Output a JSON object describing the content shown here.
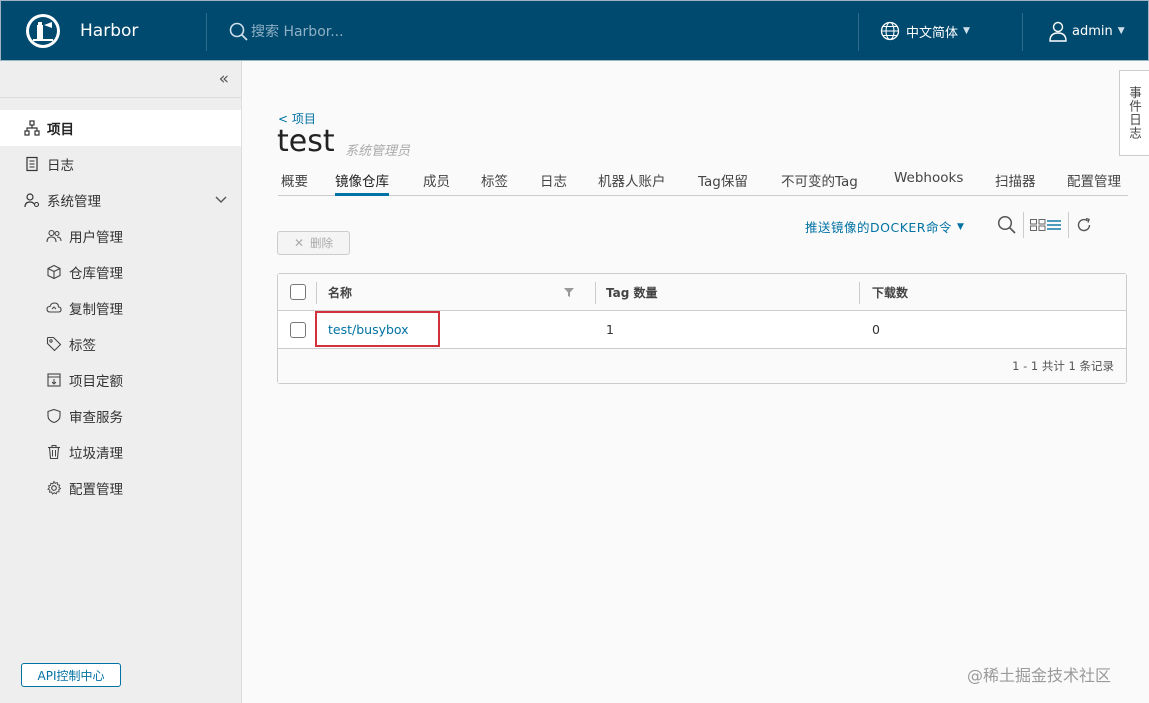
{
  "header": {
    "brand": "Harbor",
    "search_placeholder": "搜索 Harbor...",
    "language": "中文简体",
    "user": "admin",
    "bg_color": "#004a70"
  },
  "sidebar": {
    "items": [
      {
        "label": "项目",
        "icon": "project-icon",
        "active": true
      },
      {
        "label": "日志",
        "icon": "log-icon"
      },
      {
        "label": "系统管理",
        "icon": "admin-icon",
        "expanded": true
      }
    ],
    "sub_items": [
      {
        "label": "用户管理",
        "icon": "users-icon"
      },
      {
        "label": "仓库管理",
        "icon": "box-icon"
      },
      {
        "label": "复制管理",
        "icon": "cloud-icon"
      },
      {
        "label": "标签",
        "icon": "tag-icon"
      },
      {
        "label": "项目定额",
        "icon": "quota-icon"
      },
      {
        "label": "审查服务",
        "icon": "shield-icon"
      },
      {
        "label": "垃圾清理",
        "icon": "trash-icon"
      },
      {
        "label": "配置管理",
        "icon": "gear-icon"
      }
    ],
    "api_button": "API控制中心"
  },
  "event_log_tab": "事件日志",
  "project": {
    "breadcrumb": "< 项目",
    "title": "test",
    "role": "系统管理员"
  },
  "tabs": [
    {
      "label": "概要"
    },
    {
      "label": "镜像仓库",
      "active": true
    },
    {
      "label": "成员"
    },
    {
      "label": "标签"
    },
    {
      "label": "日志"
    },
    {
      "label": "机器人账户"
    },
    {
      "label": "Tag保留"
    },
    {
      "label": "不可变的Tag"
    },
    {
      "label": "Webhooks"
    },
    {
      "label": "扫描器"
    },
    {
      "label": "配置管理"
    }
  ],
  "toolbar": {
    "push_command": "推送镜像的DOCKER命令",
    "delete_label": "删除"
  },
  "table": {
    "columns": [
      "名称",
      "Tag 数量",
      "下载数"
    ],
    "rows": [
      {
        "name": "test/busybox",
        "tags": "1",
        "downloads": "0"
      }
    ],
    "pagination": "1 - 1 共计 1 条记录"
  },
  "watermark": "@稀土掘金技术社区",
  "colors": {
    "accent": "#0072a3",
    "highlight": "#d0313a"
  }
}
